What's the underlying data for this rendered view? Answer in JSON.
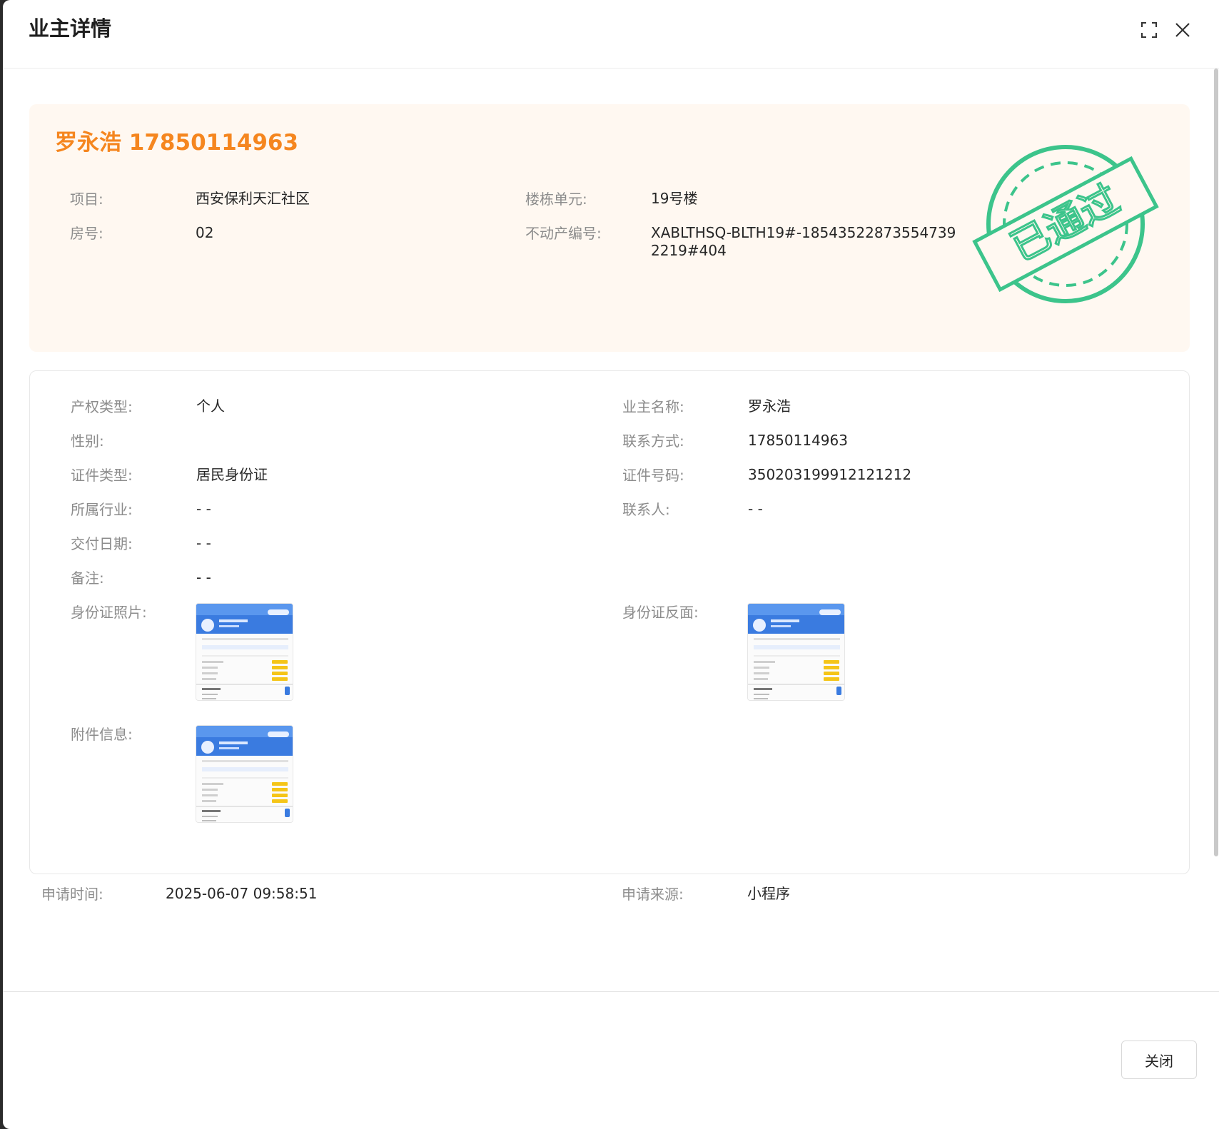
{
  "dialog": {
    "title": "业主详情",
    "fullscreen_icon": "fullscreen-icon",
    "close_icon": "close-icon"
  },
  "summary": {
    "owner_name": "罗永浩",
    "owner_phone": "17850114963",
    "project_label": "项目:",
    "project_value": "西安保利天汇社区",
    "building_label": "楼栋单元:",
    "building_value": "19号楼",
    "room_label": "房号:",
    "room_value": "02",
    "property_no_label": "不动产编号:",
    "property_no_value": "XABLTHSQ-BLTH19#-185435228735547392219#404",
    "stamp_text": "已通过",
    "stamp_color": "#3cc48b",
    "accent_color": "#f5861f"
  },
  "details": {
    "ownership_type_label": "产权类型:",
    "ownership_type_value": "个人",
    "owner_name_label": "业主名称:",
    "owner_name_value": "罗永浩",
    "gender_label": "性别:",
    "gender_value": "",
    "contact_label": "联系方式:",
    "contact_value": "17850114963",
    "id_type_label": "证件类型:",
    "id_type_value": "居民身份证",
    "id_number_label": "证件号码:",
    "id_number_value": "350203199912121212",
    "industry_label": "所属行业:",
    "industry_value": "- -",
    "contact_person_label": "联系人:",
    "contact_person_value": "- -",
    "delivery_date_label": "交付日期:",
    "delivery_date_value": "- -",
    "remark_label": "备注:",
    "remark_value": "- -",
    "id_photo_label": "身份证照片:",
    "id_back_label": "身份证反面:",
    "attachment_label": "附件信息:"
  },
  "footer_info": {
    "apply_time_label": "申请时间:",
    "apply_time_value": "2025-06-07 09:58:51",
    "apply_source_label": "申请来源:",
    "apply_source_value": "小程序"
  },
  "footer": {
    "close_label": "关闭"
  }
}
